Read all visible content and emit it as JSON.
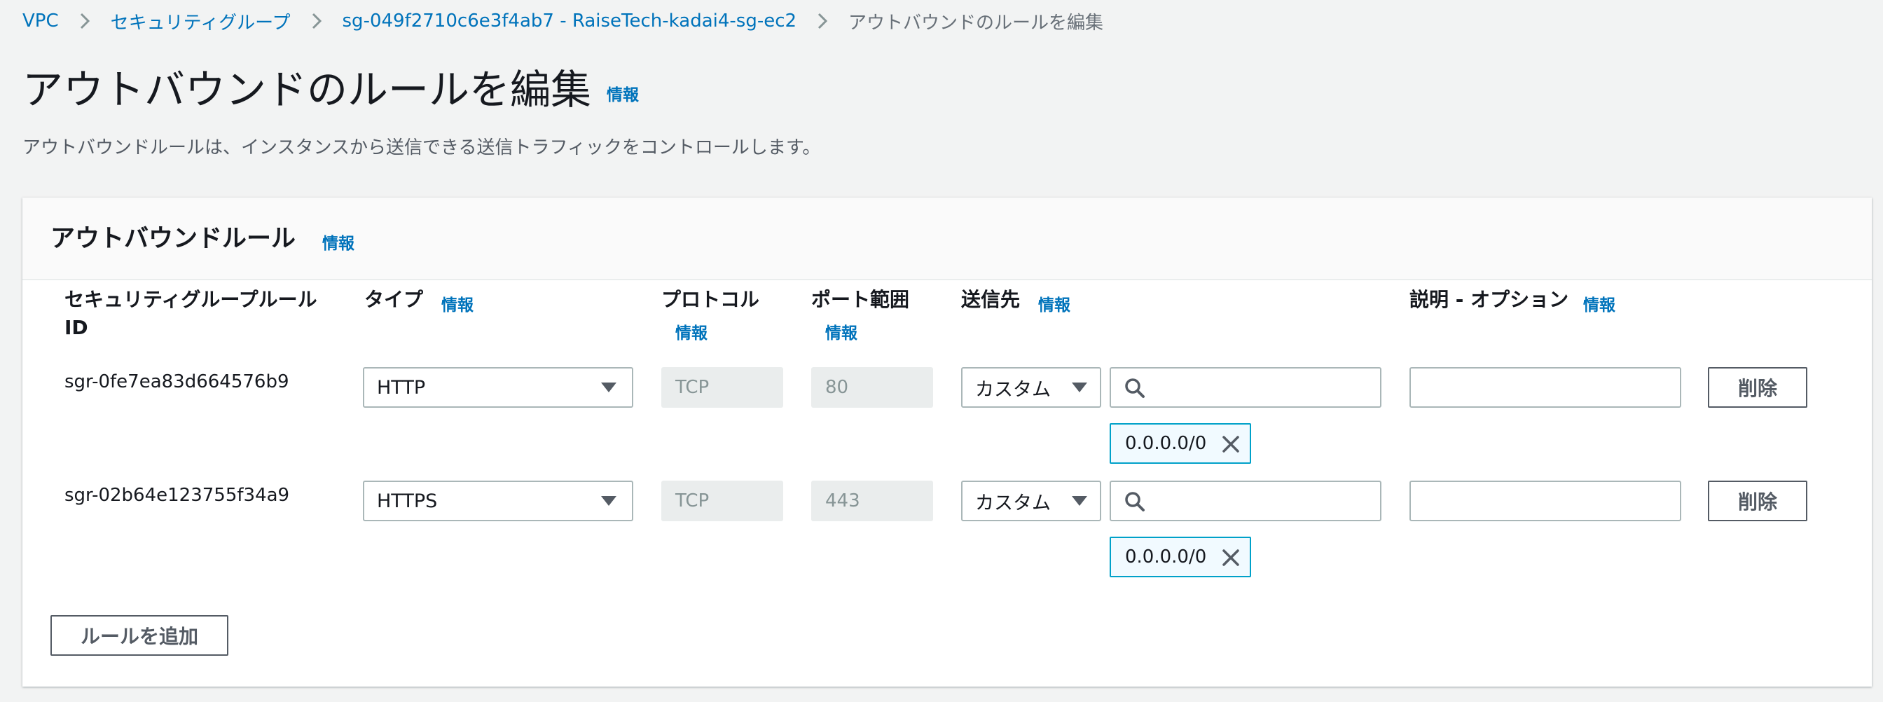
{
  "breadcrumb": {
    "items": [
      "VPC",
      "セキュリティグループ",
      "sg-049f2710c6e3f4ab7 - RaiseTech-kadai4-sg-ec2"
    ],
    "current": "アウトバウンドのルールを編集"
  },
  "page": {
    "title": "アウトバウンドのルールを編集",
    "info": "情報",
    "description": "アウトバウンドルールは、インスタンスから送信できる送信トラフィックをコントロールします。"
  },
  "panel": {
    "title": "アウトバウンドルール",
    "info": "情報",
    "columns": {
      "rule_id_line1": "セキュリティグループルール",
      "rule_id_line2": "ID",
      "type": "タイプ",
      "protocol": "プロトコル",
      "port_range": "ポート範囲",
      "destination": "送信先",
      "description": "説明 - オプション",
      "info": "情報"
    },
    "rules": [
      {
        "id": "sgr-0fe7ea83d664576b9",
        "type": "HTTP",
        "protocol": "TCP",
        "port": "80",
        "dest_type": "カスタム",
        "search_value": "",
        "token": "0.0.0.0/0",
        "description": "",
        "delete": "削除"
      },
      {
        "id": "sgr-02b64e123755f34a9",
        "type": "HTTPS",
        "protocol": "TCP",
        "port": "443",
        "dest_type": "カスタム",
        "search_value": "",
        "token": "0.0.0.0/0",
        "description": "",
        "delete": "削除"
      }
    ],
    "add_rule": "ルールを追加"
  },
  "colors": {
    "link": "#0073bb",
    "background": "#f2f3f3",
    "token_border": "#00a1c9",
    "token_bg": "#f1faff"
  },
  "icons": [
    "chevron-right-icon",
    "caret-down-icon",
    "search-icon",
    "close-icon"
  ]
}
